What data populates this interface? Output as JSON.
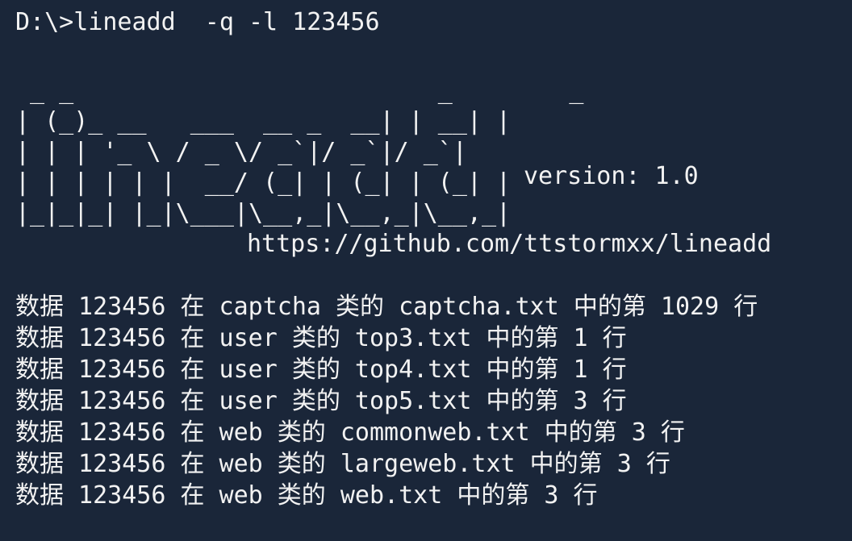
{
  "terminal": {
    "prompt": "D:\\>",
    "command": "lineadd  -q -l 123456"
  },
  "banner": {
    "art": [
      " _ _                         _        _",
      "| (_)_ __   ___  __ _  __| | __| |",
      "| | | '_ \\ / _ \\/ _`|/ _`|/ _`|",
      "| | | | | |  __/ (_| | (_| | (_| |",
      "|_|_|_| |_|\\___|\\__,_|\\__,_|\\__,_|"
    ],
    "version": "version: 1.0",
    "url": "https://github.com/ttstormxx/lineadd"
  },
  "results": [
    "数据 123456 在 captcha 类的 captcha.txt 中的第 1029 行",
    "数据 123456 在 user 类的 top3.txt 中的第 1 行",
    "数据 123456 在 user 类的 top4.txt 中的第 1 行",
    "数据 123456 在 user 类的 top5.txt 中的第 3 行",
    "数据 123456 在 web 类的 commonweb.txt 中的第 3 行",
    "数据 123456 在 web 类的 largeweb.txt 中的第 3 行",
    "数据 123456 在 web 类的 web.txt 中的第 3 行"
  ],
  "colors": {
    "background": "#1a2639",
    "text": "#f2f2f2"
  }
}
